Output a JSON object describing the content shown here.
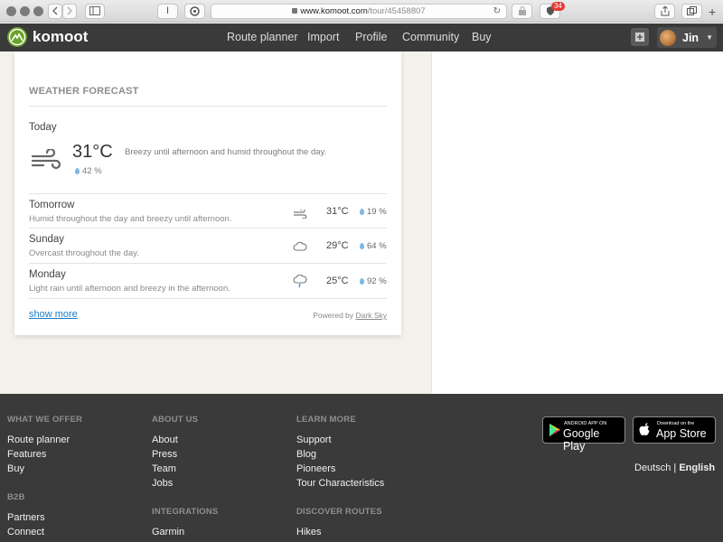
{
  "browser": {
    "url_domain": "www.komoot.com",
    "url_path": "/tour/45458807",
    "reader_button": "I",
    "extension_badge": "34"
  },
  "nav": {
    "logo_text": "komoot",
    "links": [
      "Route planner",
      "Import",
      "Profile",
      "Community",
      "Buy"
    ],
    "user_name": "Jin",
    "caret": "▼"
  },
  "weather": {
    "title": "WEATHER FORECAST",
    "today": {
      "label": "Today",
      "temp": "31°C",
      "rain": "42 %",
      "description": "Breezy until afternoon and humid throughout the day.",
      "icon": "wind-icon"
    },
    "forecast": [
      {
        "day": "Tomorrow",
        "description": "Humid throughout the day and breezy until afternoon.",
        "temp": "31°C",
        "rain": "19 %",
        "icon": "wind-icon"
      },
      {
        "day": "Sunday",
        "description": "Overcast throughout the day.",
        "temp": "29°C",
        "rain": "64 %",
        "icon": "cloud-icon"
      },
      {
        "day": "Monday",
        "description": "Light rain until afternoon and breezy in the afternoon.",
        "temp": "25°C",
        "rain": "92 %",
        "icon": "rain-cloud-icon"
      }
    ],
    "show_more": "show more",
    "powered_prefix": "Powered by",
    "powered_link": "Dark Sky"
  },
  "footer": {
    "what_we_offer": {
      "heading": "WHAT WE OFFER",
      "links": [
        "Route planner",
        "Features",
        "Buy"
      ]
    },
    "b2b": {
      "heading": "B2B",
      "links": [
        "Partners",
        "Connect"
      ]
    },
    "about_us": {
      "heading": "ABOUT US",
      "links": [
        "About",
        "Press",
        "Team",
        "Jobs"
      ]
    },
    "integrations": {
      "heading": "INTEGRATIONS",
      "links": [
        "Garmin"
      ]
    },
    "learn_more": {
      "heading": "LEARN MORE",
      "links": [
        "Support",
        "Blog",
        "Pioneers",
        "Tour Characteristics"
      ]
    },
    "discover_routes": {
      "heading": "DISCOVER ROUTES",
      "links": [
        "Hikes"
      ]
    },
    "google_play": {
      "small": "ANDROID APP ON",
      "big": "Google Play"
    },
    "app_store": {
      "small": "Download on the",
      "big": "App Store"
    },
    "lang_de": "Deutsch",
    "lang_sep": "|",
    "lang_en": "English"
  },
  "colors": {
    "brand_green": "#6aa127",
    "nav_bg": "#3a3a3a",
    "link_blue": "#1c7cc8",
    "rain_drop": "#7cb8e4"
  }
}
